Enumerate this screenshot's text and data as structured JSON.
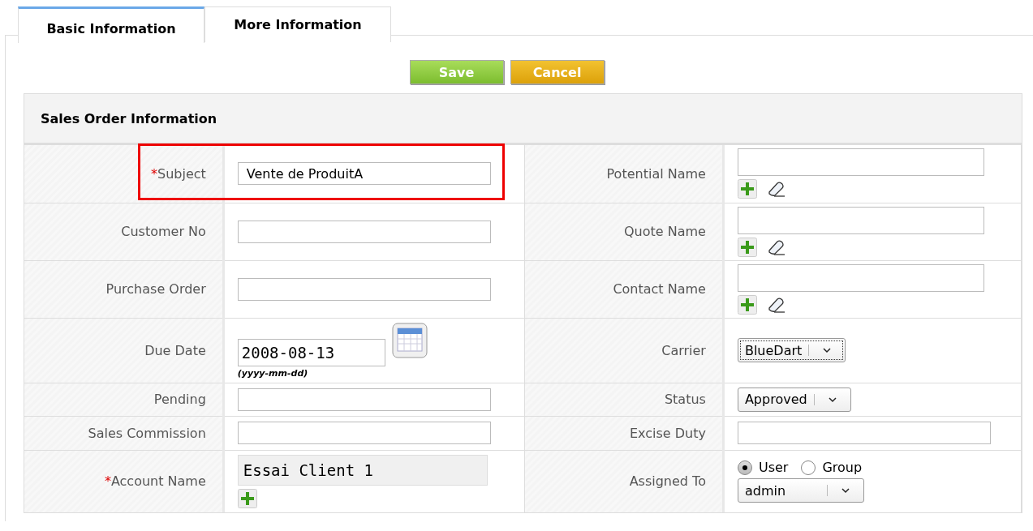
{
  "tabs": [
    {
      "label": "Basic Information",
      "selected": true
    },
    {
      "label": "More Information",
      "selected": false
    }
  ],
  "buttons": [
    {
      "label": "Save",
      "kind": "save"
    },
    {
      "label": "Cancel",
      "kind": "cancel"
    }
  ],
  "section": {
    "title": "Sales Order Information",
    "rows": [
      {
        "highlighted": true,
        "left": {
          "label": "Subject",
          "required_mark": "*",
          "kind": "text",
          "value": "Vente de ProduitA"
        },
        "right": {
          "label": "Potential Name",
          "kind": "lookup"
        }
      },
      {
        "highlighted": false,
        "left": {
          "label": "Customer No",
          "kind": "text"
        },
        "right": {
          "label": "Quote Name",
          "kind": "lookup"
        }
      },
      {
        "highlighted": false,
        "left": {
          "label": "Purchase Order",
          "kind": "text"
        },
        "right": {
          "label": "Contact Name",
          "kind": "lookup"
        }
      },
      {
        "highlighted": false,
        "left": {
          "label": "Due Date",
          "kind": "date",
          "value": "2008-08-13",
          "hint": "(yyyy-mm-dd)"
        },
        "right": {
          "label": "Carrier",
          "kind": "select",
          "value": "BlueDart",
          "focused": true
        }
      },
      {
        "highlighted": false,
        "left": {
          "label": "Pending",
          "kind": "text"
        },
        "right": {
          "label": "Status",
          "kind": "select",
          "value": "Approved",
          "focused": false
        }
      },
      {
        "highlighted": false,
        "left": {
          "label": "Sales Commission",
          "kind": "text"
        },
        "right": {
          "label": "Excise Duty",
          "kind": "text"
        }
      },
      {
        "highlighted": false,
        "left": {
          "label": "Account Name",
          "required_mark": "*",
          "kind": "account",
          "value": "Essai Client 1"
        },
        "right": {
          "label": "Assigned To",
          "kind": "assign",
          "options": [
            {
              "label": "User",
              "selected": true
            },
            {
              "label": "Group",
              "selected": false
            }
          ],
          "value": "admin"
        }
      }
    ]
  }
}
